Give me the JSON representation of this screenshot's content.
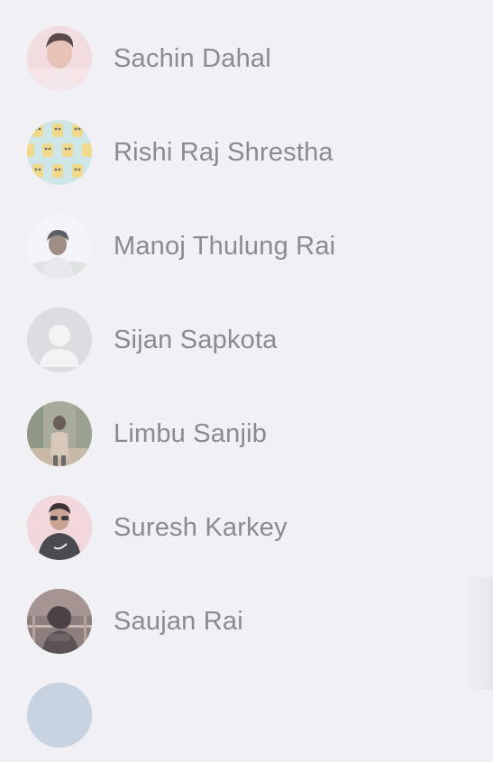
{
  "contacts": [
    {
      "name": "Sachin Dahal",
      "avatar": "photo-avatar"
    },
    {
      "name": "Rishi Raj Shrestha",
      "avatar": "cartoon-pattern-avatar"
    },
    {
      "name": "Manoj Thulung Rai",
      "avatar": "photo-avatar"
    },
    {
      "name": "Sijan Sapkota",
      "avatar": "default-person-avatar"
    },
    {
      "name": "Limbu Sanjib",
      "avatar": "photo-avatar"
    },
    {
      "name": "Suresh Karkey",
      "avatar": "photo-avatar"
    },
    {
      "name": "Saujan Rai",
      "avatar": "photo-avatar"
    },
    {
      "name": "",
      "avatar": "photo-avatar"
    }
  ],
  "colors": {
    "background": "#f0f0f5",
    "name_text": "#8a8a8f"
  }
}
